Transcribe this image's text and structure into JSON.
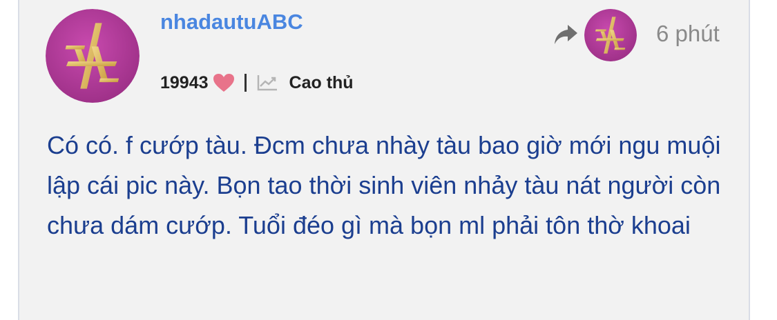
{
  "post": {
    "username": "nhadautuABC",
    "score": "19943",
    "rank": "Cao thủ",
    "time": "6 phút",
    "content": "Có có. f cướp tàu. Đcm chưa nhày tàu bao giờ mới ngu muội lập cái pic này. Bọn tao thời sinh viên nhảy tàu nát người còn chưa dám cướp. Tuổi đéo gì mà bọn ml phải tôn thờ khoai"
  },
  "icons": {
    "avatar": "ab-monogram-avatar",
    "heart": "heart-icon",
    "rank": "trend-chart-icon",
    "share": "share-arrow-icon"
  },
  "colors": {
    "username": "#4a86e0",
    "content": "#1b3e8f",
    "heart": "#e8738a",
    "avatar_bg": "#b6399c",
    "monogram": "#d8b35a",
    "card_bg": "#f2f2f2"
  }
}
